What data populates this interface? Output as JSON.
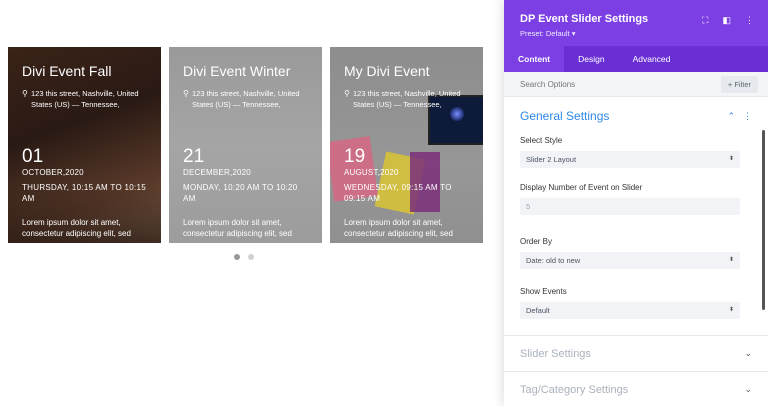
{
  "slider": {
    "cards": [
      {
        "title": "Divi Event Fall",
        "address": "123 this street, Nashville, United States (US) — Tennessee,",
        "day": "01",
        "month_year": "OCTOBER,2020",
        "time": "THURSDAY, 10:15 AM TO 10:15 AM",
        "description": "Lorem ipsum dolor sit amet, consectetur adipiscing elit, sed"
      },
      {
        "title": "Divi Event Winter",
        "address": "123 this street, Nashville, United States (US) — Tennessee,",
        "day": "21",
        "month_year": "DECEMBER,2020",
        "time": "MONDAY, 10:20 AM TO 10:20 AM",
        "description": "Lorem ipsum dolor sit amet, consectetur adipiscing elit, sed"
      },
      {
        "title": "My Divi Event",
        "address": "123 this street, Nashville, United States (US) — Tennessee,",
        "day": "19",
        "month_year": "AUGUST,2020",
        "time": "WEDNESDAY, 09:15 AM TO 09:15 AM",
        "description": "Lorem ipsum dolor sit amet, consectetur adipiscing elit, sed"
      }
    ],
    "pagination": {
      "count": 2,
      "active": 0
    }
  },
  "panel": {
    "title": "DP Event Slider Settings",
    "preset": "Preset: Default ▾",
    "icons": [
      "expand-icon",
      "split-view-icon",
      "more-vertical-icon"
    ],
    "tabs": [
      "Content",
      "Design",
      "Advanced"
    ],
    "active_tab": "Content",
    "search_placeholder": "Search Options",
    "filter_label": "+ Filter",
    "general": {
      "title": "General Settings",
      "select_style_label": "Select Style",
      "select_style_value": "Slider 2 Layout",
      "display_number_label": "Display Number of Event on Slider",
      "display_number_value": "5",
      "order_by_label": "Order By",
      "order_by_value": "Date: old to new",
      "show_events_label": "Show Events",
      "show_events_value": "Default"
    },
    "collapsed_sections": [
      "Slider Settings",
      "Tag/Category Settings"
    ]
  },
  "colors": {
    "accent": "#7b3fe4",
    "tabs_bg": "#6a2fd4",
    "link_blue": "#2c89e8"
  }
}
